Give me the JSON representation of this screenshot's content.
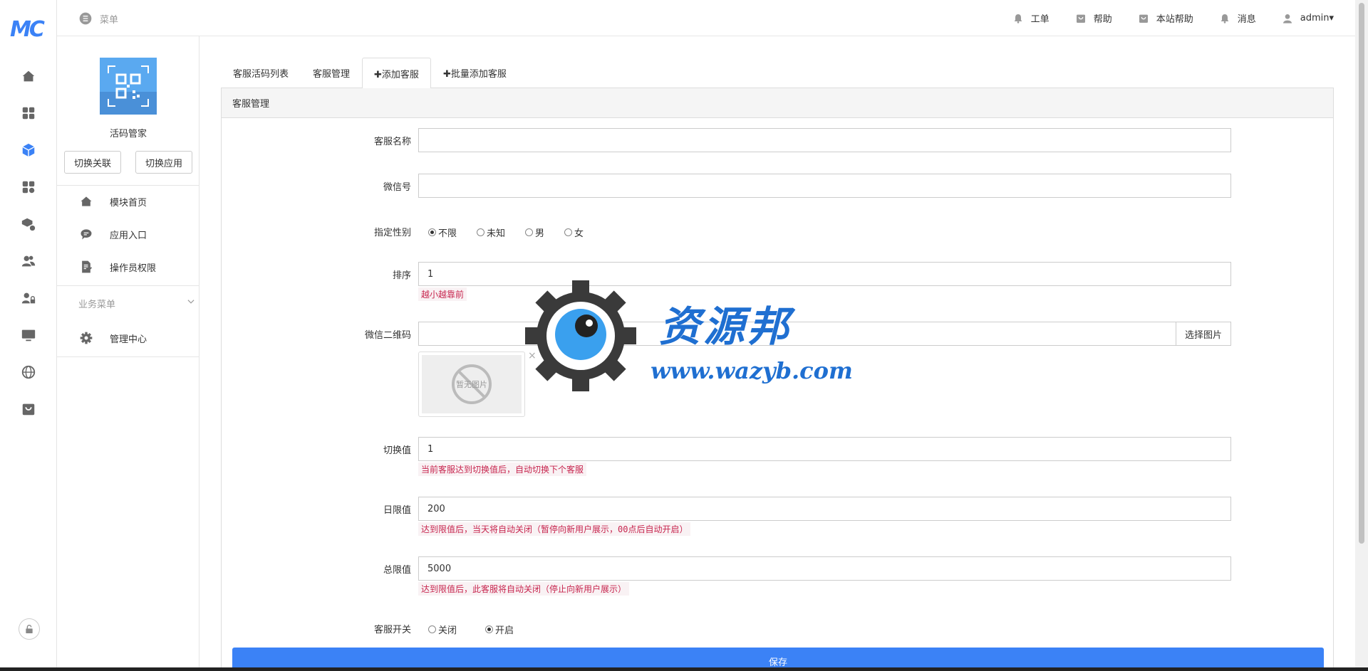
{
  "header": {
    "menu_label": "菜单",
    "nav": [
      {
        "label": "工单",
        "icon": "bell-icon"
      },
      {
        "label": "帮助",
        "icon": "bag-icon"
      },
      {
        "label": "本站帮助",
        "icon": "bag-icon"
      },
      {
        "label": "消息",
        "icon": "bell-icon"
      },
      {
        "label": "admin▾",
        "icon": "user-icon"
      }
    ]
  },
  "rail": {
    "logo": "MC",
    "icons": [
      "home-icon",
      "grid-icon",
      "cube-icon",
      "apps-icon",
      "box-settings-icon",
      "users-icon",
      "user-lock-icon",
      "monitor-icon",
      "globe-icon",
      "store-icon"
    ],
    "active_index": 2,
    "bottom_icon": "lock-icon"
  },
  "sidebar": {
    "app_name": "活码管家",
    "switch_link_label": "切换关联",
    "switch_app_label": "切换应用",
    "items": [
      {
        "label": "模块首页",
        "icon": "home-icon"
      },
      {
        "label": "应用入口",
        "icon": "chat-icon"
      },
      {
        "label": "操作员权限",
        "icon": "document-edit-icon"
      }
    ],
    "group_label": "业务菜单",
    "group_items": [
      {
        "label": "管理中心",
        "icon": "gear-icon"
      }
    ]
  },
  "tabs": [
    {
      "label": "客服活码列表",
      "active": false
    },
    {
      "label": "客服管理",
      "active": false
    },
    {
      "label": "✚添加客服",
      "active": true
    },
    {
      "label": "✚批量添加客服",
      "active": false
    }
  ],
  "panel": {
    "title": "客服管理",
    "fields": {
      "name": {
        "label": "客服名称",
        "value": ""
      },
      "wechat": {
        "label": "微信号",
        "value": ""
      },
      "gender": {
        "label": "指定性别",
        "options": [
          "不限",
          "未知",
          "男",
          "女"
        ],
        "selected": "不限"
      },
      "sort": {
        "label": "排序",
        "value": "1",
        "hint": "越小越靠前"
      },
      "qrcode": {
        "label": "微信二维码",
        "value": "",
        "button": "选择图片",
        "placeholder_text": "暂无图片",
        "remove": "×"
      },
      "switch_value": {
        "label": "切换值",
        "value": "1",
        "hint": "当前客服达到切换值后，自动切换下个客服"
      },
      "daily_limit": {
        "label": "日限值",
        "value": "200",
        "hint": "达到限值后，当天将自动关闭（暂停向新用户展示，00点后自动开启）"
      },
      "total_limit": {
        "label": "总限值",
        "value": "5000",
        "hint": "达到限值后，此客服将自动关闭（停止向新用户展示）"
      },
      "status": {
        "label": "客服开关",
        "options": [
          "关闭",
          "开启"
        ],
        "selected": "开启"
      }
    },
    "save_label": "保存"
  },
  "watermark": {
    "title": "资源邦",
    "url": "www.wazyb.com"
  },
  "colors": {
    "accent": "#3b82f6",
    "hint_text": "#c7254e",
    "hint_bg": "#f9f2f4",
    "watermark": "#1f6fd1"
  }
}
